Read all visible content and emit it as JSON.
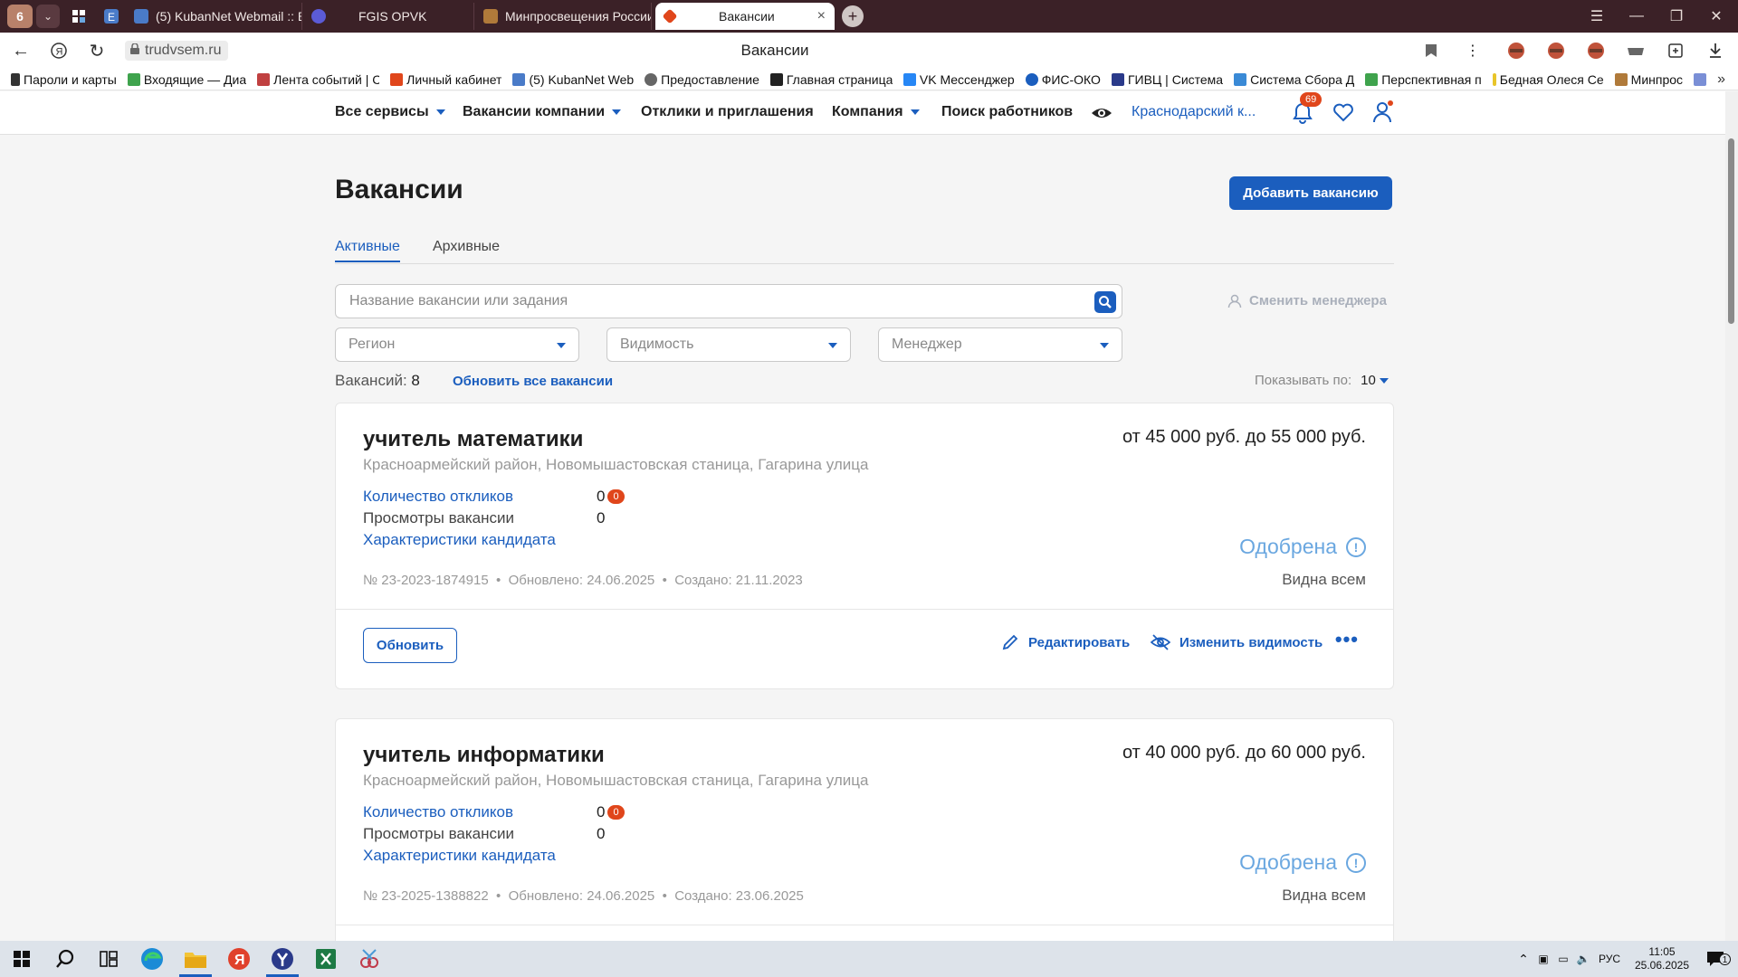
{
  "browser": {
    "tab_count": "6",
    "tabs": [
      {
        "label": "(5) KubanNet Webmail :: В",
        "color": "#4a7bc8"
      },
      {
        "label": "FGIS OPVK",
        "color": "#5b5bd6"
      },
      {
        "label": "Минпросвещения России",
        "color": "#b07a3a"
      },
      {
        "label": "Вакансии",
        "color": "#e0461b",
        "close": "×"
      }
    ],
    "url": "trudvsem.ru",
    "page_title": "Вакансии",
    "bookmarks": [
      {
        "label": "Пароли и карты",
        "color": "#333"
      },
      {
        "label": "Входящие — Диа",
        "color": "#3fa34d"
      },
      {
        "label": "Лента событий | С",
        "color": "#c04040"
      },
      {
        "label": "Личный кабинет",
        "color": "#e0461b"
      },
      {
        "label": "(5) KubanNet Web",
        "color": "#4a7bc8"
      },
      {
        "label": "Предоставление",
        "color": "#666"
      },
      {
        "label": "Главная страница",
        "color": "#222"
      },
      {
        "label": "VK Мессенджер",
        "color": "#2787f5"
      },
      {
        "label": "ФИС-ОКО",
        "color": "#1b5ebe"
      },
      {
        "label": "ГИВЦ | Система",
        "color": "#2a3a8a"
      },
      {
        "label": "Система Сбора Д",
        "color": "#3a8ad6"
      },
      {
        "label": "Перспективная п",
        "color": "#3fa34d"
      },
      {
        "label": "Бедная Олеся Се",
        "color": "#e8c52a"
      },
      {
        "label": "Минпрос",
        "color": "#b07a3a"
      }
    ]
  },
  "header": {
    "nav": [
      "Все сервисы",
      "Вакансии компании",
      "Отклики и приглашения",
      "Компания",
      "Поиск работников"
    ],
    "region": "Краснодарский к...",
    "notifications": "69"
  },
  "page": {
    "title": "Вакансии",
    "add_button": "Добавить вакансию",
    "tabs": [
      "Активные",
      "Архивные"
    ],
    "search_placeholder": "Название  вакансии или задания",
    "change_manager": "Сменить менеджера",
    "filters": [
      "Регион",
      "Видимость",
      "Менеджер"
    ],
    "count_label": "Вакансий:",
    "count_value": "8",
    "refresh_all": "Обновить все вакансии",
    "per_page_label": "Показывать по:",
    "per_page_value": "10"
  },
  "vacancies": [
    {
      "title": "учитель математики",
      "salary": "от 45 000 руб. до 55 000 руб.",
      "address": "Красноармейский район, Новомышастовская станица, Гагарина улица",
      "responses_label": "Количество откликов",
      "responses_value": "0",
      "responses_badge": "0",
      "views_label": "Просмотры вакансии",
      "views_value": "0",
      "characteristics": "Характеристики кандидата",
      "status": "Одобрена",
      "number": "№ 23-2023-1874915",
      "updated": "Обновлено: 24.06.2025",
      "created": "Создано: 21.11.2023",
      "visibility": "Видна всем",
      "refresh": "Обновить",
      "edit": "Редактировать",
      "change_visibility": "Изменить видимость",
      "more": "•••"
    },
    {
      "title": "учитель информатики",
      "salary": "от 40 000 руб. до 60 000 руб.",
      "address": "Красноармейский район, Новомышастовская станица, Гагарина улица",
      "responses_label": "Количество откликов",
      "responses_value": "0",
      "responses_badge": "0",
      "views_label": "Просмотры вакансии",
      "views_value": "0",
      "characteristics": "Характеристики кандидата",
      "status": "Одобрена",
      "number": "№ 23-2025-1388822",
      "updated": "Обновлено: 24.06.2025",
      "created": "Создано: 23.06.2025",
      "visibility": "Видна всем"
    }
  ],
  "taskbar": {
    "lang": "РУС",
    "time": "11:05",
    "date": "25.06.2025",
    "notif": "1"
  },
  "colors": {
    "accent": "#1b5ebe",
    "status": "#6aa7e0",
    "badge": "#e0461b"
  }
}
